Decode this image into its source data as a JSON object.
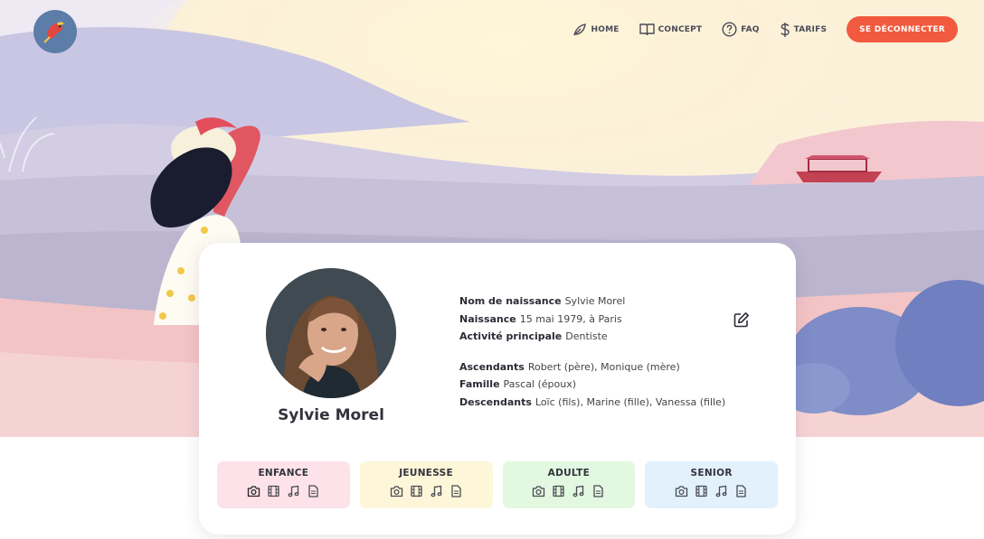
{
  "nav": {
    "items": [
      {
        "label": "HOME",
        "icon": "leaf-icon"
      },
      {
        "label": "CONCEPT",
        "icon": "book-icon"
      },
      {
        "label": "FAQ",
        "icon": "question-icon"
      },
      {
        "label": "TARIFS",
        "icon": "dollar-icon"
      }
    ],
    "logout_label": "SE DÉCONNECTER"
  },
  "profile": {
    "name": "Sylvie Morel",
    "details": [
      {
        "key": "Nom de naissance",
        "value": "Sylvie Morel"
      },
      {
        "key": "Naissance",
        "value": "15 mai 1979, à Paris"
      },
      {
        "key": "Activité principale",
        "value": "Dentiste"
      }
    ],
    "family": [
      {
        "key": "Ascendants",
        "value": "Robert (père), Monique (mère)"
      },
      {
        "key": "Famille",
        "value": "Pascal (époux)"
      },
      {
        "key": "Descendants",
        "value": "Loïc (fils), Marine (fille), Vanessa (fille)"
      }
    ]
  },
  "periods": [
    {
      "label": "ENFANCE",
      "color": "#fde3e9"
    },
    {
      "label": "JEUNESSE",
      "color": "#fdf6d8"
    },
    {
      "label": "ADULTE",
      "color": "#e2f8e0"
    },
    {
      "label": "SENIOR",
      "color": "#e2f1fc"
    }
  ],
  "period_icons": [
    "camera-icon",
    "film-icon",
    "music-icon",
    "document-icon"
  ],
  "colors": {
    "accent": "#f15a3e",
    "logo_bg": "#5b7da8"
  }
}
